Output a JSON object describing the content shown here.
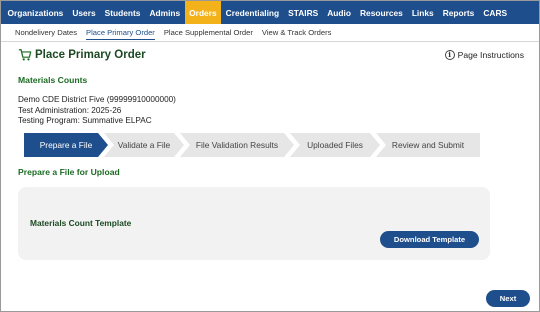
{
  "topnav": {
    "items": [
      {
        "label": "Organizations"
      },
      {
        "label": "Users"
      },
      {
        "label": "Students"
      },
      {
        "label": "Admins"
      },
      {
        "label": "Orders"
      },
      {
        "label": "Credentialing"
      },
      {
        "label": "STAIRS"
      },
      {
        "label": "Audio"
      },
      {
        "label": "Resources"
      },
      {
        "label": "Links"
      },
      {
        "label": "Reports"
      },
      {
        "label": "CARS"
      }
    ],
    "active": "Orders"
  },
  "subnav": {
    "items": [
      {
        "label": "Nondelivery Dates"
      },
      {
        "label": "Place Primary Order"
      },
      {
        "label": "Place Supplemental Order"
      },
      {
        "label": "View & Track Orders"
      }
    ],
    "active": "Place Primary Order"
  },
  "page": {
    "title": "Place Primary Order",
    "instructions_label": "Page Instructions",
    "materials_heading": "Materials Counts",
    "district": "Demo CDE District Five (99999910000000)",
    "test_administration": "Test Administration: 2025-26",
    "testing_program": "Testing Program: Summative ELPAC",
    "upload_heading": "Prepare a File for Upload"
  },
  "wizard": {
    "steps": [
      {
        "label": "Prepare a File"
      },
      {
        "label": "Validate a File"
      },
      {
        "label": "File Validation Results"
      },
      {
        "label": "Uploaded Files"
      },
      {
        "label": "Review and Submit"
      }
    ],
    "active_index": 0
  },
  "panel": {
    "label": "Materials Count Template",
    "download_label": "Download Template"
  },
  "footer": {
    "next_label": "Next"
  },
  "colors": {
    "nav_bg": "#1f4e8c",
    "nav_active": "#f3b21a",
    "heading_green": "#1c6b23",
    "step_inactive": "#e6e6e6"
  }
}
